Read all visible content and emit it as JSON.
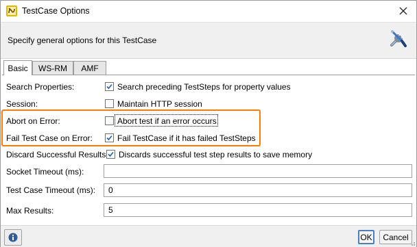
{
  "window": {
    "title": "TestCase Options"
  },
  "header": {
    "description": "Specify general options for this TestCase"
  },
  "tabs": [
    {
      "label": "Basic",
      "active": true
    },
    {
      "label": "WS-RM",
      "active": false
    },
    {
      "label": "AMF",
      "active": false
    }
  ],
  "options": [
    {
      "label": "Search Properties:",
      "checkbox_label": "Search preceding TestSteps for property values",
      "checked": true
    },
    {
      "label": "Session:",
      "checkbox_label": "Maintain HTTP session",
      "checked": false
    },
    {
      "label": "Abort on Error:",
      "checkbox_label": "Abort test if an error occurs",
      "checked": false
    },
    {
      "label": "Fail Test Case on Error:",
      "checkbox_label": "Fail TestCase if it has failed TestSteps",
      "checked": true
    },
    {
      "label": "Discard Successful Results:",
      "checkbox_label": "Discards successful test step results to save memory",
      "checked": true
    }
  ],
  "fields": [
    {
      "label": "Socket Timeout (ms):",
      "value": ""
    },
    {
      "label": "Test Case Timeout (ms):",
      "value": "0"
    },
    {
      "label": "Max Results:",
      "value": "5"
    }
  ],
  "footer": {
    "ok_label": "OK",
    "cancel_label": "Cancel"
  },
  "colors": {
    "highlight": "#ff7a00",
    "header_bg": "#f0f0f0",
    "check": "#1f5fbf"
  },
  "icons": {
    "app": "soapui-app-icon",
    "close": "close-icon",
    "tools": "tools-icon",
    "info": "info-icon"
  }
}
